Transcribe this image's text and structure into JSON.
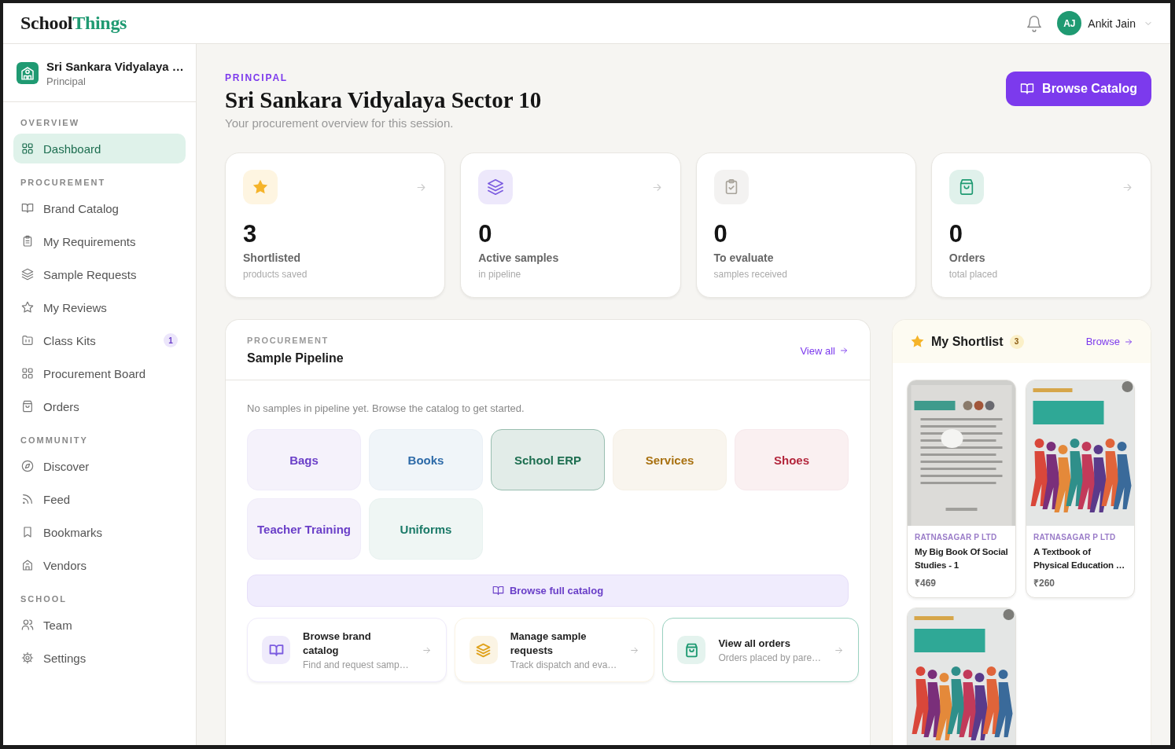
{
  "logo": {
    "primary": "School",
    "accent": "Things"
  },
  "user": {
    "initials": "AJ",
    "name": "Ankit Jain"
  },
  "org": {
    "name": "Sri Sankara Vidyalaya …",
    "role": "Principal"
  },
  "sidebar": {
    "sections": [
      {
        "title": "OVERVIEW",
        "items": [
          {
            "label": "Dashboard",
            "selected": true
          }
        ]
      },
      {
        "title": "PROCUREMENT",
        "items": [
          {
            "label": "Brand Catalog",
            "selected": false
          },
          {
            "label": "My Requirements",
            "selected": false
          },
          {
            "label": "Sample Requests",
            "selected": false
          },
          {
            "label": "My Reviews",
            "selected": false
          },
          {
            "label": "Class Kits",
            "selected": false,
            "badge": "1"
          },
          {
            "label": "Procurement Board",
            "selected": false
          },
          {
            "label": "Orders",
            "selected": false
          }
        ]
      },
      {
        "title": "COMMUNITY",
        "items": [
          {
            "label": "Discover",
            "selected": false
          },
          {
            "label": "Feed",
            "selected": false
          },
          {
            "label": "Bookmarks",
            "selected": false
          },
          {
            "label": "Vendors",
            "selected": false
          }
        ]
      },
      {
        "title": "SCHOOL",
        "items": [
          {
            "label": "Team",
            "selected": false
          },
          {
            "label": "Settings",
            "selected": false
          }
        ]
      }
    ]
  },
  "page": {
    "role": "PRINCIPAL",
    "title": "Sri Sankara Vidyalaya Sector 10",
    "subtitle": "Your procurement overview for this session.",
    "button": "Browse Catalog"
  },
  "stats": [
    {
      "value": "3",
      "label": "Shortlisted",
      "caption": "products saved",
      "color": "#f5b42a",
      "arrow": true
    },
    {
      "value": "0",
      "label": "Active samples",
      "caption": "in pipeline",
      "color": "#7c5ce0",
      "arrow": true
    },
    {
      "value": "0",
      "label": "To evaluate",
      "caption": "samples received",
      "color": "#a8a39a",
      "arrow": false
    },
    {
      "value": "0",
      "label": "Orders",
      "caption": "total placed",
      "color": "#1f9a72",
      "arrow": true
    }
  ],
  "pipeline": {
    "eyebrow": "PROCUREMENT",
    "title": "Sample Pipeline",
    "link": "View all",
    "empty": "No samples in pipeline yet. Browse the catalog to get started.",
    "categories": [
      {
        "label": "Bags",
        "color": "#6a3fc8",
        "selected": false
      },
      {
        "label": "Books",
        "color": "#2d6aa8",
        "selected": false
      },
      {
        "label": "School ERP",
        "color": "#1d6e50",
        "selected": true
      },
      {
        "label": "Services",
        "color": "#a8700f",
        "selected": false
      },
      {
        "label": "Shoes",
        "color": "#b3263c",
        "selected": false
      },
      {
        "label": "Teacher Training",
        "color": "#6a3fc8",
        "selected": false
      },
      {
        "label": "Uniforms",
        "color": "#1b7a68",
        "selected": false
      }
    ],
    "browse_full": "Browse full catalog",
    "actions": [
      {
        "title": "Browse brand catalog",
        "subtitle": "Find and request samp…",
        "color": "#7c5ce0",
        "selected": false
      },
      {
        "title": "Manage sample requests",
        "subtitle": "Track dispatch and eva…",
        "color": "#e0a21c",
        "selected": false
      },
      {
        "title": "View all orders",
        "subtitle": "Orders placed by pare…",
        "color": "#1f9a72",
        "selected": true
      }
    ]
  },
  "shortlist": {
    "title": "My Shortlist",
    "count": "3",
    "link": "Browse",
    "products": [
      {
        "kind": "page",
        "vendor": "RATNASAGAR P LTD",
        "name": "My Big Book Of Social Studies - 1",
        "price": "₹469"
      },
      {
        "kind": "cover",
        "vendor": "RATNASAGAR P LTD",
        "name": "A Textbook of Physical Education …",
        "price": "₹260"
      },
      {
        "kind": "cover"
      }
    ]
  }
}
